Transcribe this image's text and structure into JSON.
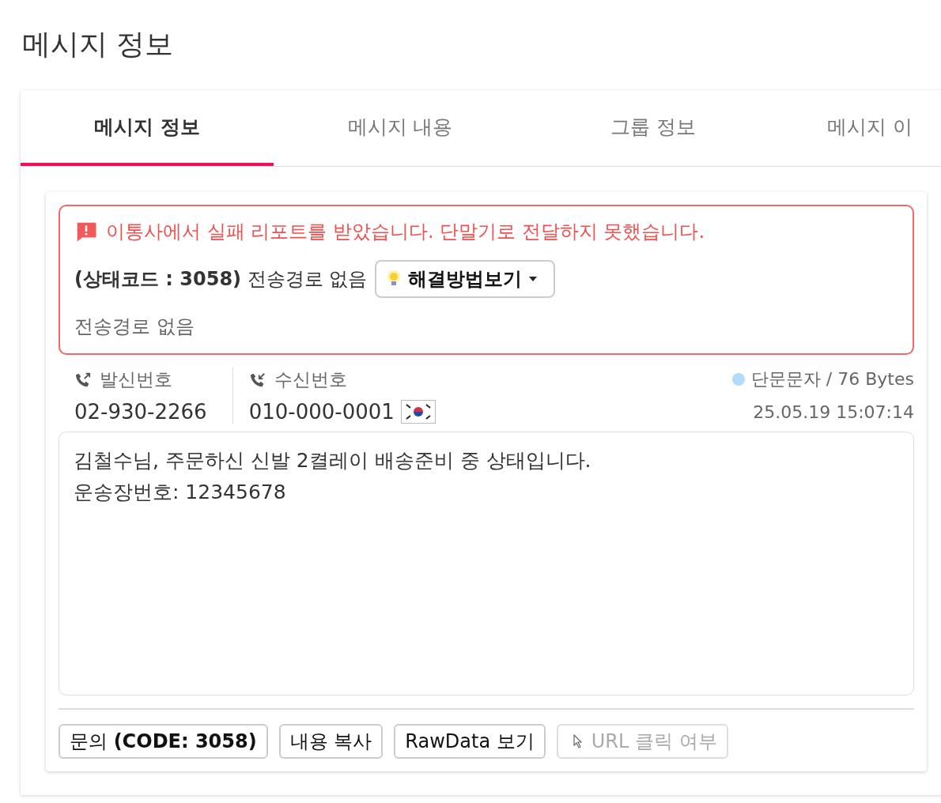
{
  "page_title": "메시지 정보",
  "tabs": [
    {
      "label": "메시지 정보",
      "selected": true
    },
    {
      "label": "메시지 내용",
      "selected": false
    },
    {
      "label": "그룹 정보",
      "selected": false
    },
    {
      "label": "메시지 이",
      "selected": false
    }
  ],
  "alert": {
    "message": "이통사에서 실패 리포트를 받았습니다. 단말기로 전달하지 못했습니다.",
    "status": "**(상태코드 : 3058)** 전송경로 없음",
    "solution_button": "해결방법보기",
    "detail": "전송경로 없음"
  },
  "sender": {
    "label": "발신번호",
    "number": "02-930-2266"
  },
  "receiver": {
    "label": "수신번호",
    "number": "010-000-0001"
  },
  "message_type": {
    "label": "단문문자 / 76 Bytes",
    "color": "#b3d9fb"
  },
  "timestamp": "25.05.19 15:07:14",
  "body": [
    "김철수님, 주문하신 신발 2켤레이 배송준비 중 상태입니다.",
    "운송장번호: 12345678"
  ],
  "actions": [
    {
      "label": "문의 **(CODE: 3058)**",
      "disabled": false,
      "kind": "text"
    },
    {
      "label": "내용 복사",
      "disabled": false,
      "kind": "text"
    },
    {
      "label": "RawData 보기",
      "disabled": false,
      "kind": "text"
    },
    {
      "label": "URL 클릭 여부",
      "disabled": true,
      "kind": "pointer"
    }
  ]
}
